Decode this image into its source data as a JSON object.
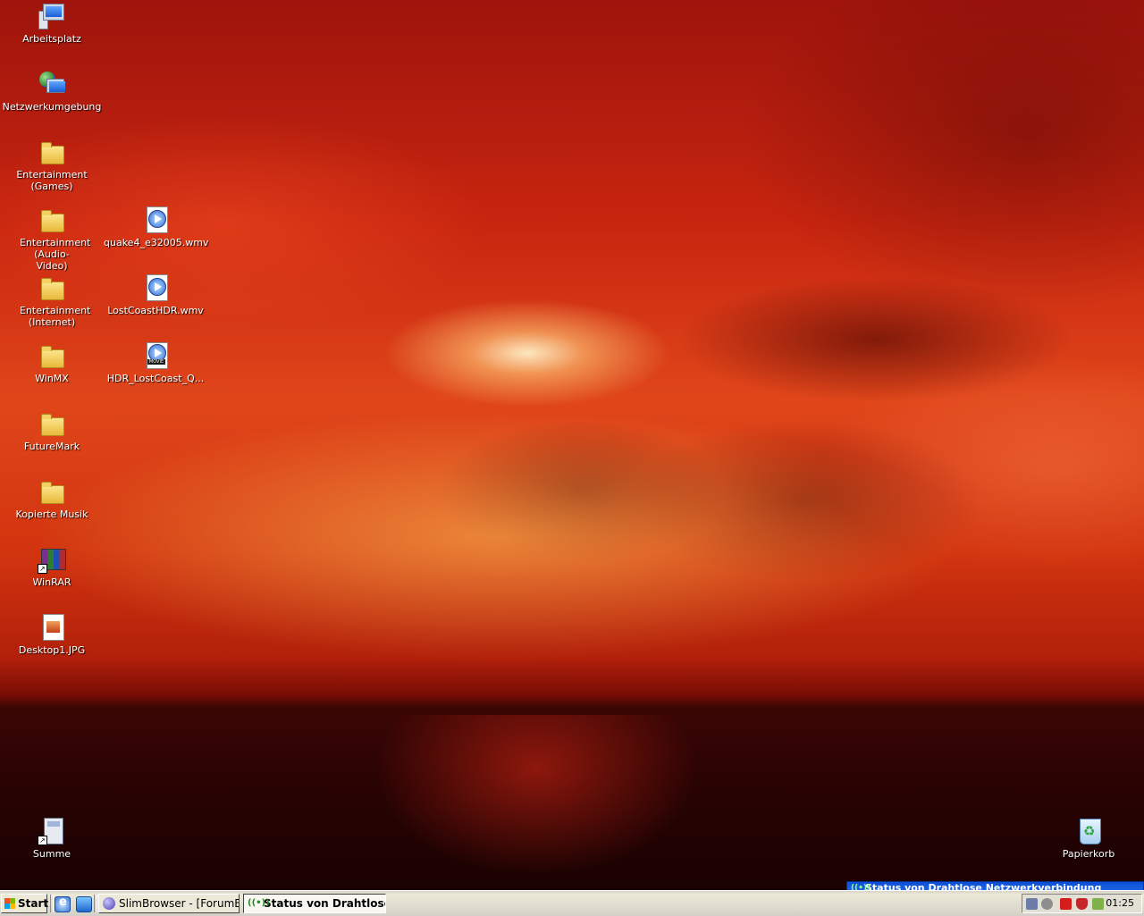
{
  "desktop": {
    "icons": [
      {
        "label": "Arbeitsplatz",
        "icon": "my-computer-icon"
      },
      {
        "label": "Netzwerkumgebung",
        "icon": "network-places-icon"
      },
      {
        "label": "Entertainment (Games)",
        "icon": "folder-icon"
      },
      {
        "label": "Entertainment (Audio-Video)",
        "icon": "folder-icon"
      },
      {
        "label": "Entertainment (Internet)",
        "icon": "folder-icon"
      },
      {
        "label": "WinMX",
        "icon": "folder-icon"
      },
      {
        "label": "FutureMark",
        "icon": "folder-icon"
      },
      {
        "label": "Kopierte Musik",
        "icon": "folder-icon"
      },
      {
        "label": "WinRAR",
        "icon": "winrar-icon"
      },
      {
        "label": "Desktop1.JPG",
        "icon": "image-file-icon"
      },
      {
        "label": "quake4_e32005.wmv",
        "icon": "media-file-icon"
      },
      {
        "label": "LostCoastHDR.wmv",
        "icon": "media-file-icon"
      },
      {
        "label": "HDR_LostCoast_Q...",
        "icon": "movie-file-icon"
      },
      {
        "label": "Summe",
        "icon": "calculator-shortcut-icon"
      },
      {
        "label": "Papierkorb",
        "icon": "recycle-bin-icon"
      }
    ]
  },
  "notification": {
    "title": "Status von Drahtlose Netzwerkverbindung"
  },
  "taskbar": {
    "start_label": "Start",
    "tasks": [
      {
        "label": "SlimBrowser - [ForumBas...",
        "active": false
      },
      {
        "label": "Status von Drahtlose ...",
        "active": true
      }
    ],
    "clock": "01:25"
  }
}
